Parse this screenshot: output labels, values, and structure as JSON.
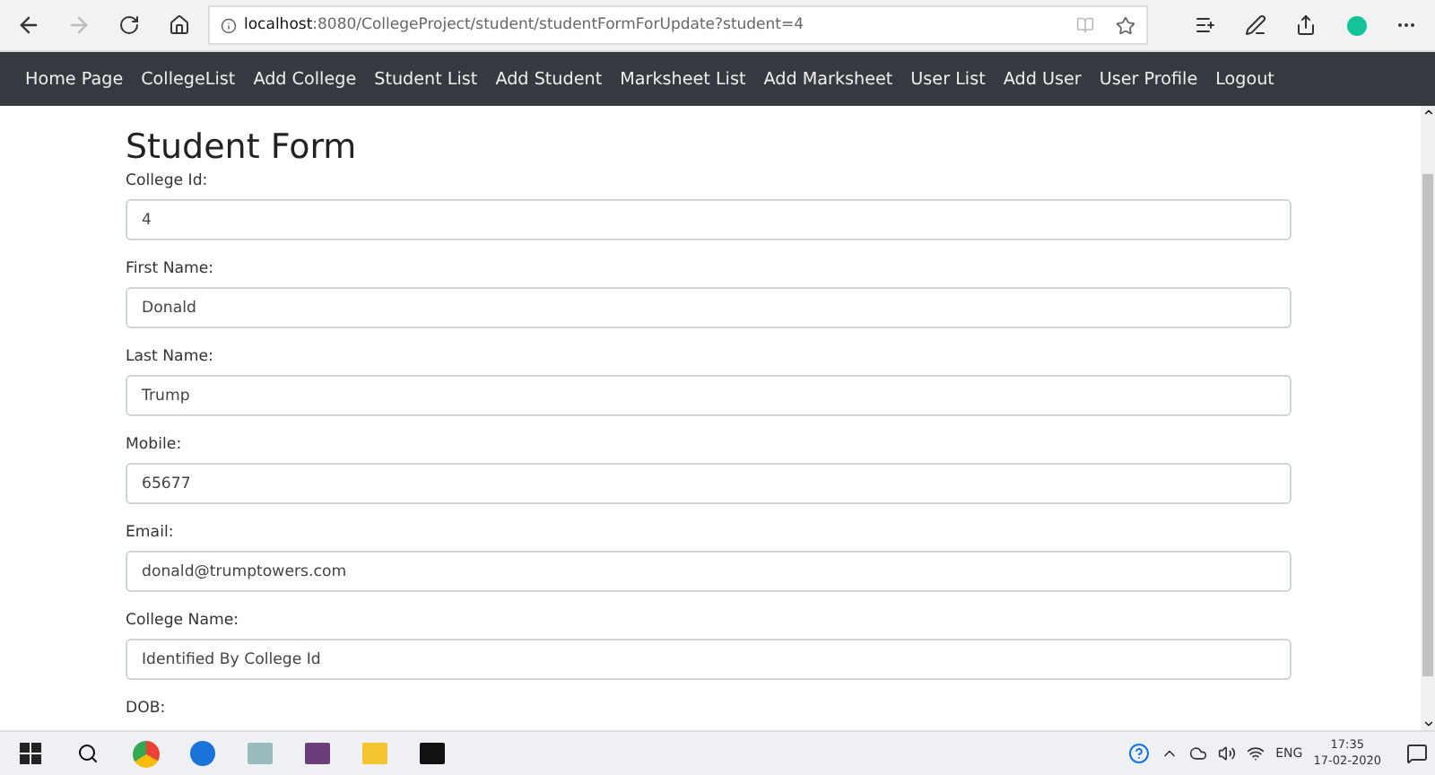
{
  "browser": {
    "url_host": "localhost",
    "url_rest": ":8080/CollegeProject/student/studentFormForUpdate?student=4"
  },
  "nav": [
    {
      "label": "Home Page"
    },
    {
      "label": "CollegeList"
    },
    {
      "label": "Add College"
    },
    {
      "label": "Student List"
    },
    {
      "label": "Add Student"
    },
    {
      "label": "Marksheet List"
    },
    {
      "label": "Add Marksheet"
    },
    {
      "label": "User List"
    },
    {
      "label": "Add User"
    },
    {
      "label": "User Profile"
    },
    {
      "label": "Logout"
    }
  ],
  "form": {
    "title": "Student Form",
    "fields": [
      {
        "label": "College Id:",
        "value": "4"
      },
      {
        "label": "First Name:",
        "value": "Donald"
      },
      {
        "label": "Last Name:",
        "value": "Trump"
      },
      {
        "label": "Mobile:",
        "value": "65677"
      },
      {
        "label": "Email:",
        "value": "donald@trumptowers.com"
      },
      {
        "label": "College Name:",
        "value": "Identified By College Id"
      }
    ],
    "next_label": "DOB:"
  },
  "taskbar": {
    "language": "ENG",
    "time": "17:35",
    "date": "17-02-2020"
  }
}
